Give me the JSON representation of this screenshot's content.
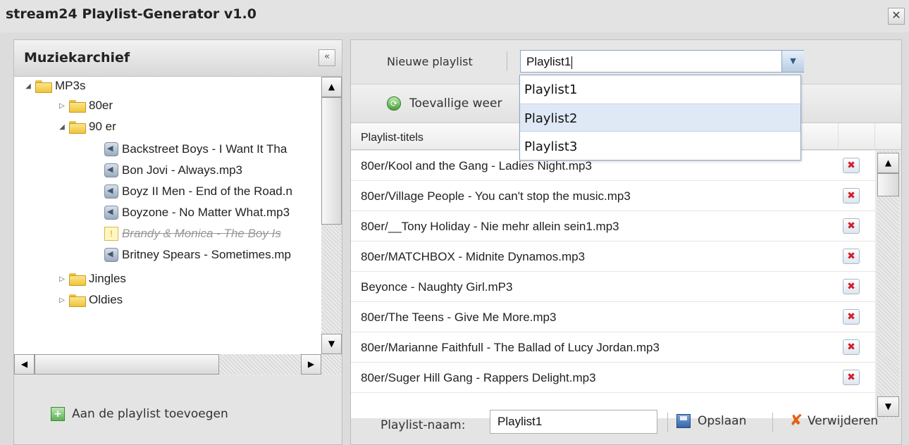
{
  "window": {
    "title": "stream24 Playlist-Generator v1.0",
    "close_symbol": "✕"
  },
  "left_panel": {
    "title": "Muziekarchief",
    "collapse_symbol": "«",
    "tree": [
      {
        "label": "MP3s",
        "type": "folder",
        "expanded": true,
        "level": 0
      },
      {
        "label": "80er",
        "type": "folder",
        "expanded": false,
        "level": 1
      },
      {
        "label": "90 er",
        "type": "folder",
        "expanded": true,
        "level": 1
      },
      {
        "label": "Backstreet Boys - I Want It Tha",
        "type": "audio",
        "level": 2
      },
      {
        "label": "Bon Jovi - Always.mp3",
        "type": "audio",
        "level": 2
      },
      {
        "label": "Boyz II Men - End of the Road.n",
        "type": "audio",
        "level": 2
      },
      {
        "label": "Boyzone - No Matter What.mp3",
        "type": "audio",
        "level": 2
      },
      {
        "label": "Brandy & Monica - The Boy Is",
        "type": "warning",
        "level": 2
      },
      {
        "label": "Britney Spears - Sometimes.mp",
        "type": "audio",
        "level": 2
      },
      {
        "label": "Jingles",
        "type": "folder",
        "expanded": false,
        "level": 1
      },
      {
        "label": "Oldies",
        "type": "folder",
        "expanded": false,
        "level": 1
      }
    ],
    "add_button_label": "Aan de playlist toevoegen"
  },
  "right_panel": {
    "new_playlist_label": "Nieuwe playlist",
    "playlist_combo_value": "Playlist1",
    "playlist_options": [
      "Playlist1",
      "Playlist2",
      "Playlist3"
    ],
    "highlighted_option": "Playlist2",
    "shuffle_label": "Toevallige weer",
    "grid_header": "Playlist-titels",
    "tracks": [
      "80er/Kool and the Gang - Ladies Night.mp3",
      "80er/Village People - You can't stop the music.mp3",
      "80er/__Tony Holiday - Nie mehr allein sein1.mp3",
      "80er/MATCHBOX - Midnite Dynamos.mp3",
      "Beyonce - Naughty Girl.mP3",
      "80er/The Teens - Give Me More.mp3",
      "80er/Marianne Faithfull - The Ballad of Lucy Jordan.mp3",
      "80er/Suger Hill Gang - Rappers Delight.mp3"
    ],
    "playlist_name_label": "Playlist-naam:",
    "playlist_name_value": "Playlist1",
    "save_label": "Opslaan",
    "delete_label": "Verwijderen"
  },
  "colors": {
    "title_bar": "#e3e3e3",
    "panel_bg": "#e8e8e8",
    "delete_red": "#d1202a",
    "selection": "#dfe9f6"
  }
}
